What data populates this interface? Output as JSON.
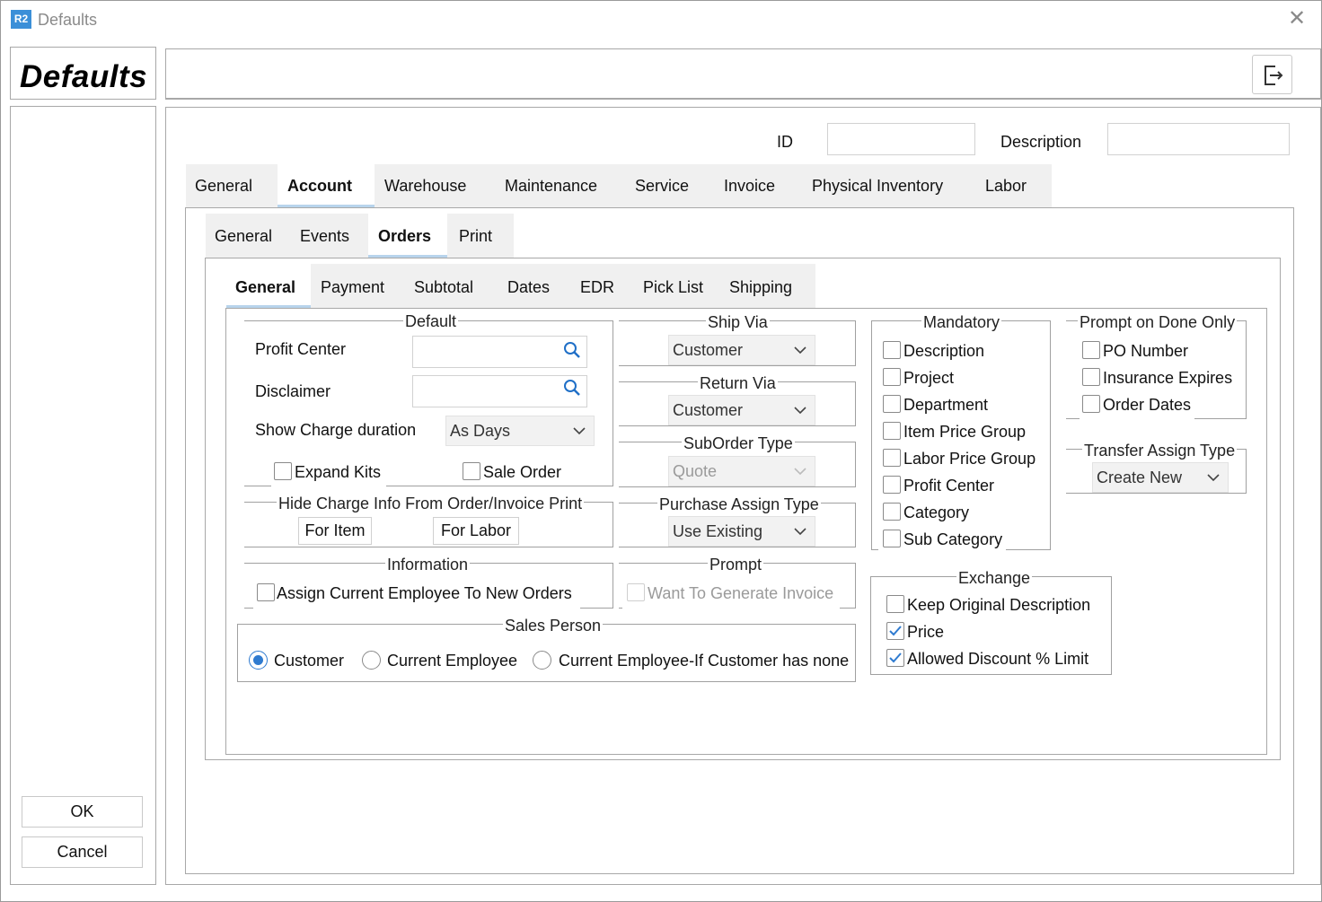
{
  "window": {
    "icon_text": "R2",
    "title": "Defaults"
  },
  "left": {
    "title": "Defaults",
    "ok": "OK",
    "cancel": "Cancel"
  },
  "header": {
    "id_label": "ID",
    "id_value": "",
    "desc_label": "Description",
    "desc_value": ""
  },
  "tabs_main": [
    "General",
    "Account",
    "Warehouse",
    "Maintenance",
    "Service",
    "Invoice",
    "Physical Inventory",
    "Labor"
  ],
  "tabs_account": [
    "General",
    "Events",
    "Orders",
    "Print"
  ],
  "tabs_orders": [
    "General",
    "Payment",
    "Subtotal",
    "Dates",
    "EDR",
    "Pick List",
    "Shipping"
  ],
  "default_group": {
    "title": "Default",
    "profit_center": "Profit Center",
    "disclaimer": "Disclaimer",
    "show_charge_duration": "Show Charge duration",
    "charge_duration_value": "As Days",
    "expand_kits": "Expand Kits",
    "sale_order": "Sale Order"
  },
  "hide_charge": {
    "title": "Hide Charge Info From Order/Invoice Print",
    "for_item": "For Item",
    "for_labor": "For Labor"
  },
  "information": {
    "title": "Information",
    "assign_employee": "Assign Current Employee To New Orders"
  },
  "sales_person": {
    "title": "Sales Person",
    "customer": "Customer",
    "current_employee": "Current Employee",
    "current_employee_if": "Current Employee-If Customer has none",
    "selected": "Customer"
  },
  "ship_via": {
    "title": "Ship Via",
    "value": "Customer"
  },
  "return_via": {
    "title": "Return Via",
    "value": "Customer"
  },
  "suborder_type": {
    "title": "SubOrder Type",
    "value": "Quote"
  },
  "purchase_assign": {
    "title": "Purchase Assign Type",
    "value": "Use Existing"
  },
  "prompt": {
    "title": "Prompt",
    "want_generate": "Want To Generate Invoice"
  },
  "mandatory": {
    "title": "Mandatory",
    "items": [
      "Description",
      "Project",
      "Department",
      "Item Price Group",
      "Labor Price Group",
      "Profit Center",
      "Category",
      "Sub Category"
    ]
  },
  "exchange": {
    "title": "Exchange",
    "keep_desc": "Keep Original Description",
    "price": "Price",
    "discount": "Allowed Discount % Limit"
  },
  "prompt_done": {
    "title": "Prompt on Done Only",
    "items": [
      "PO Number",
      "Insurance Expires",
      "Order Dates"
    ]
  },
  "transfer_assign": {
    "title": "Transfer Assign Type",
    "value": "Create New"
  },
  "colors": {
    "accent": "#2f7bd0",
    "tab_underline": "#b8d4ec",
    "tab_bg": "#f0f0f0"
  }
}
